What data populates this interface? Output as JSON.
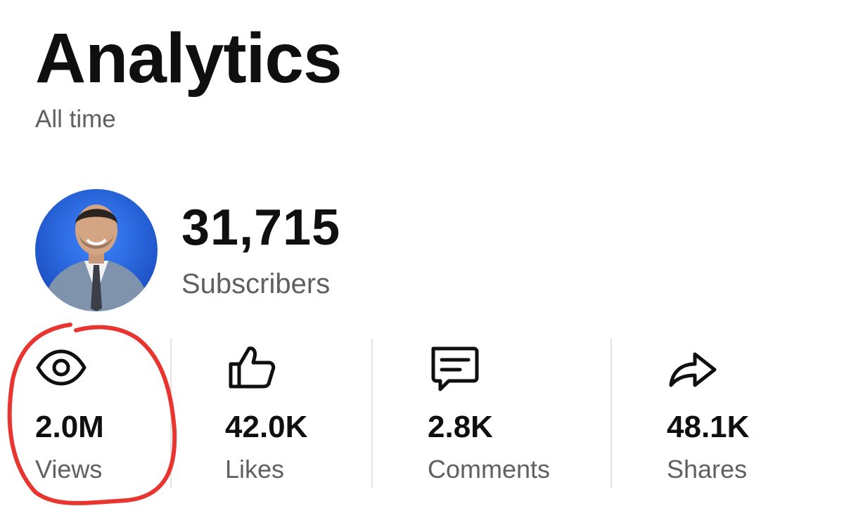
{
  "header": {
    "title": "Analytics",
    "period": "All time"
  },
  "channel": {
    "subscriber_count": "31,715",
    "subscriber_label": "Subscribers"
  },
  "stats": [
    {
      "icon": "eye-icon",
      "value": "2.0M",
      "label": "Views"
    },
    {
      "icon": "thumbs-up-icon",
      "value": "42.0K",
      "label": "Likes"
    },
    {
      "icon": "comment-icon",
      "value": "2.8K",
      "label": "Comments"
    },
    {
      "icon": "share-icon",
      "value": "48.1K",
      "label": "Shares"
    }
  ],
  "colors": {
    "text_primary": "#0f0f0f",
    "text_secondary": "#606060",
    "annotation": "#e8352f",
    "avatar_background": "#1e5fd6"
  }
}
